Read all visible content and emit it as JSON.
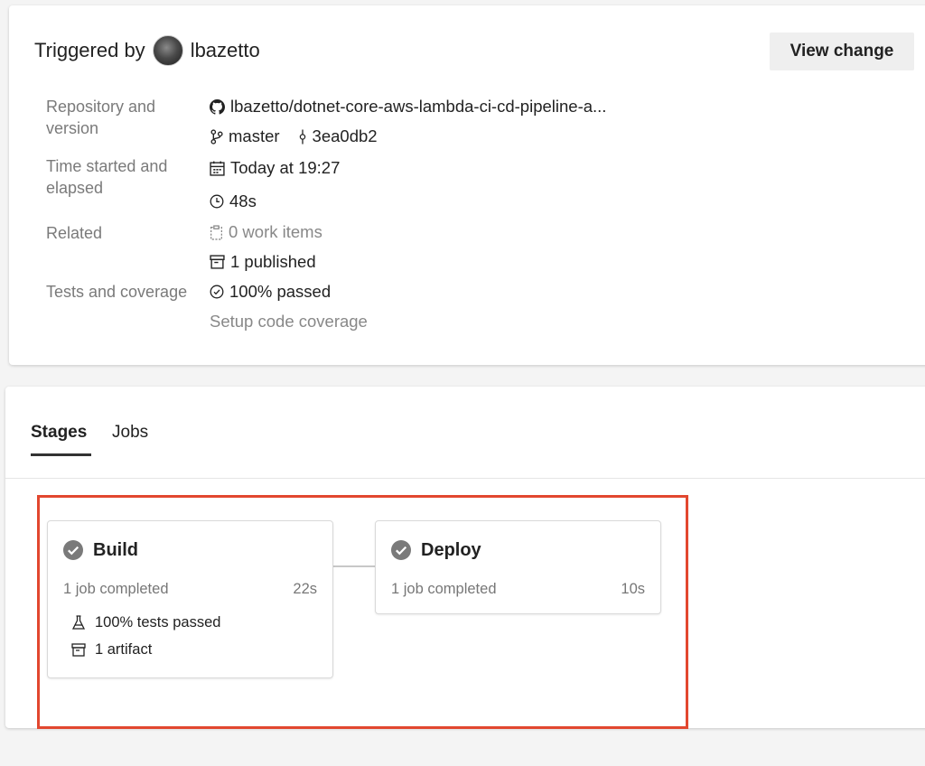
{
  "header": {
    "triggered_by_label": "Triggered by",
    "user_name": "lbazetto",
    "view_change_label": "View change"
  },
  "details": {
    "repository_label": "Repository and version",
    "repository": "lbazetto/dotnet-core-aws-lambda-ci-cd-pipeline-a...",
    "branch": "master",
    "commit": "3ea0db2",
    "time_label": "Time started and elapsed",
    "started": "Today at 19:27",
    "elapsed": "48s",
    "related_label": "Related",
    "work_items": "0 work items",
    "published": "1 published",
    "tests_label": "Tests and coverage",
    "tests_passed": "100% passed",
    "setup_coverage": "Setup code coverage"
  },
  "tabs": {
    "stages": "Stages",
    "jobs": "Jobs"
  },
  "stages": [
    {
      "name": "Build",
      "jobs": "1 job completed",
      "duration": "22s",
      "tests": "100% tests passed",
      "artifacts": "1 artifact"
    },
    {
      "name": "Deploy",
      "jobs": "1 job completed",
      "duration": "10s"
    }
  ],
  "icons": {
    "repo": "github-icon",
    "branch": "branch-icon",
    "commit": "commit-icon",
    "calendar": "calendar-icon",
    "clock": "clock-icon",
    "work_items": "clipboard-icon",
    "published": "artifact-icon",
    "tests": "check-circle-icon",
    "stage_status": "success-check-icon",
    "flask": "flask-icon"
  },
  "colors": {
    "highlight_border": "#e2472f",
    "success_icon": "#7a7a7a",
    "button_bg": "#efefef"
  }
}
